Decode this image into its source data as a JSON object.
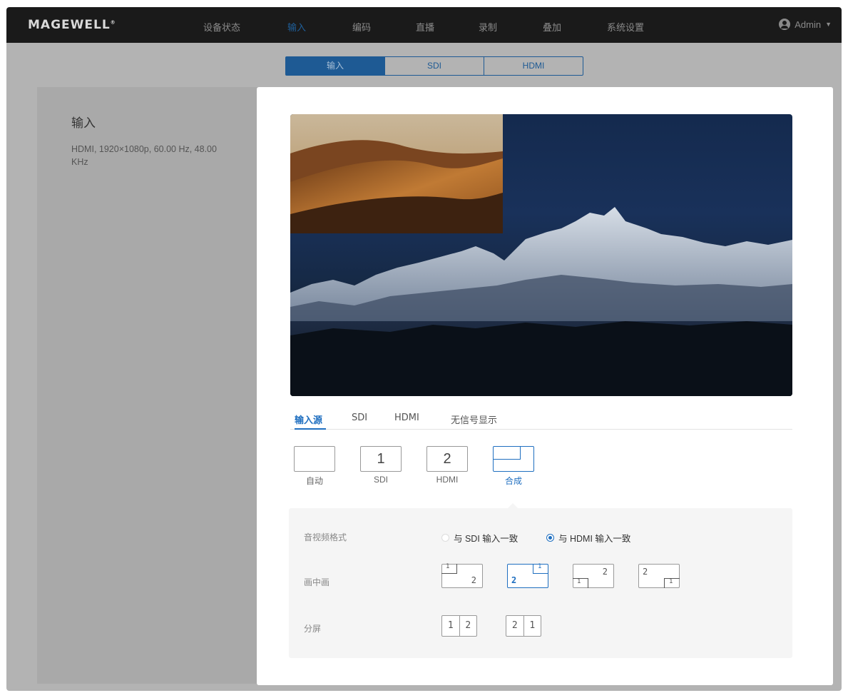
{
  "brand": {
    "logo_text": "MAGEWELL"
  },
  "nav": {
    "items": [
      {
        "label": "设备状态"
      },
      {
        "label": "输入"
      },
      {
        "label": "编码"
      },
      {
        "label": "直播"
      },
      {
        "label": "录制"
      },
      {
        "label": "叠加"
      },
      {
        "label": "系统设置"
      }
    ],
    "active": "输入",
    "user": "Admin"
  },
  "subtabs": {
    "items": [
      "输入",
      "SDI",
      "HDMI"
    ],
    "active": "输入"
  },
  "sidebar": {
    "title": "输入",
    "description": "HDMI, 1920×1080p, 60.00 Hz, 48.00 KHz"
  },
  "modal": {
    "source_tabs": [
      "输入源",
      "SDI",
      "HDMI",
      "无信号显示"
    ],
    "active_source_tab": "输入源",
    "sources": [
      {
        "box": "",
        "label": "自动"
      },
      {
        "box": "1",
        "label": "SDI"
      },
      {
        "box": "2",
        "label": "HDMI"
      },
      {
        "box": "",
        "label": "合成"
      }
    ],
    "selected_source": "合成",
    "settings": {
      "av_format_label": "音视频格式",
      "av_options": [
        "与 SDI 输入一致",
        "与 HDMI 输入一致"
      ],
      "av_selected": "与 HDMI 输入一致",
      "pip_label": "画中画",
      "pip_options": [
        {
          "main": "2",
          "inset": "1"
        },
        {
          "main": "2",
          "inset": "1"
        },
        {
          "main": "2",
          "inset": "1"
        },
        {
          "main": "2",
          "inset": "1"
        }
      ],
      "pip_selected_index": 1,
      "split_label": "分屏",
      "split_options": [
        {
          "left": "1",
          "right": "2"
        },
        {
          "left": "2",
          "right": "1"
        }
      ]
    }
  },
  "colors": {
    "accent": "#1f6fc0",
    "topbar": "#1a1a1a",
    "overlay": "#b3b3b3"
  }
}
